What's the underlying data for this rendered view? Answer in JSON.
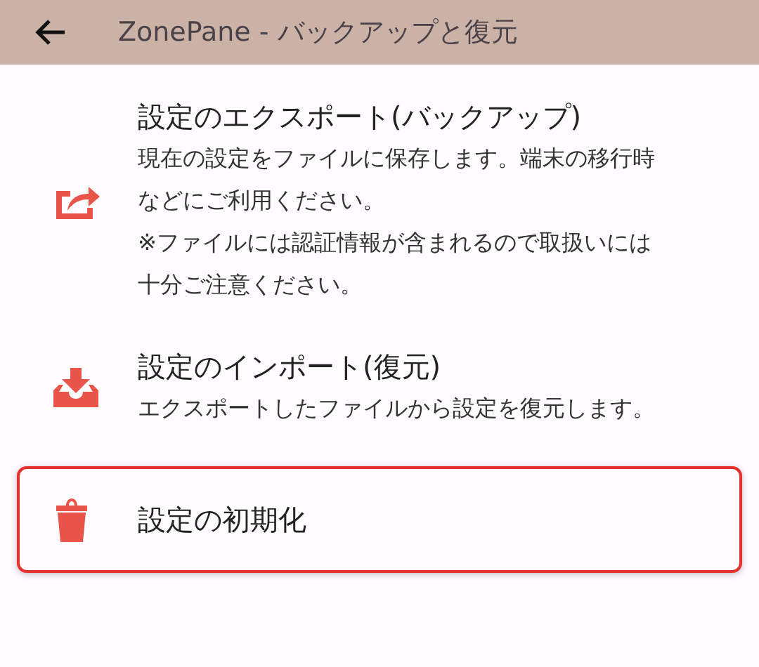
{
  "app_bar": {
    "title": "ZonePane - バックアップと復元"
  },
  "items": [
    {
      "kind": "export",
      "title": "設定のエクスポート(バックアップ)",
      "descriptions": [
        "現在の設定をファイルに保存します。端末の移行時などにご利用ください。",
        "※ファイルには認証情報が含まれるので取扱いには十分ご注意ください。"
      ],
      "highlighted": false
    },
    {
      "kind": "import",
      "title": "設定のインポート(復元)",
      "descriptions": [
        "エクスポートしたファイルから設定を復元します。"
      ],
      "highlighted": false
    },
    {
      "kind": "reset",
      "title": "設定の初期化",
      "highlighted": true
    }
  ]
}
